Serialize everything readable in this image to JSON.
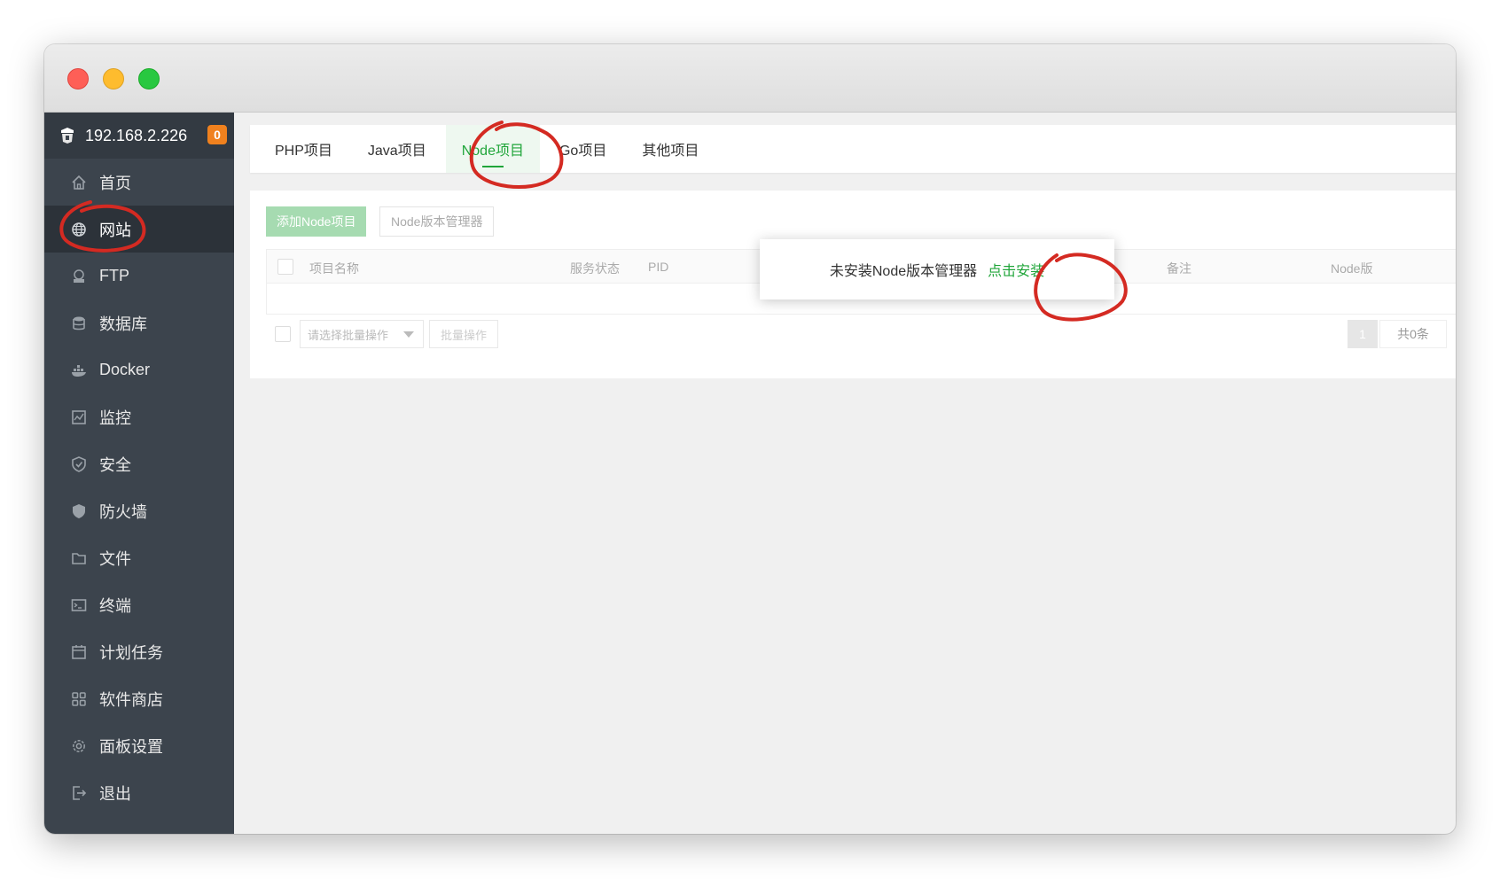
{
  "sidebar": {
    "host": "192.168.2.226",
    "badge": "0",
    "items": [
      {
        "label": "首页",
        "icon": "home-icon"
      },
      {
        "label": "网站",
        "icon": "globe-icon"
      },
      {
        "label": "FTP",
        "icon": "ftp-icon"
      },
      {
        "label": "数据库",
        "icon": "database-icon"
      },
      {
        "label": "Docker",
        "icon": "docker-icon"
      },
      {
        "label": "监控",
        "icon": "monitor-icon"
      },
      {
        "label": "安全",
        "icon": "shield-icon"
      },
      {
        "label": "防火墙",
        "icon": "firewall-icon"
      },
      {
        "label": "文件",
        "icon": "folder-icon"
      },
      {
        "label": "终端",
        "icon": "terminal-icon"
      },
      {
        "label": "计划任务",
        "icon": "calendar-icon"
      },
      {
        "label": "软件商店",
        "icon": "apps-icon"
      },
      {
        "label": "面板设置",
        "icon": "gear-icon"
      },
      {
        "label": "退出",
        "icon": "logout-icon"
      }
    ],
    "active_index": 1
  },
  "tabs": [
    {
      "label": "PHP项目"
    },
    {
      "label": "Java项目"
    },
    {
      "label": "Node项目"
    },
    {
      "label": "Go项目"
    },
    {
      "label": "其他项目"
    }
  ],
  "toolbar": {
    "add_label": "添加Node项目",
    "manager_label": "Node版本管理器"
  },
  "table": {
    "columns": [
      "项目名称",
      "服务状态",
      "PID",
      "备注",
      "Node版"
    ]
  },
  "footer": {
    "batch_placeholder": "请选择批量操作",
    "batch_button": "批量操作",
    "page": "1",
    "total": "共0条"
  },
  "popup": {
    "message": "未安装Node版本管理器",
    "link": "点击安装"
  },
  "colors": {
    "accent": "#20a53a",
    "sidebar": "#3c444d",
    "badge": "#f0811e",
    "annotation": "#d42a22"
  }
}
